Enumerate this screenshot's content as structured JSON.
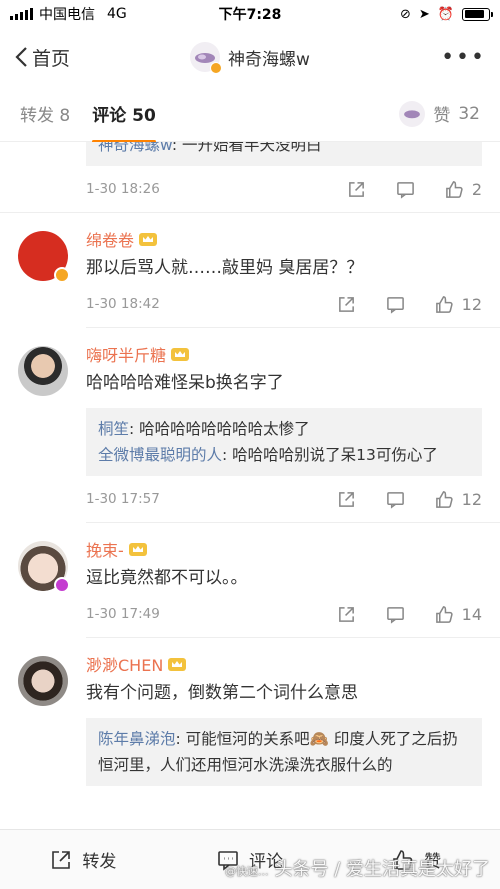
{
  "status": {
    "carrier": "中国电信",
    "network": "4G",
    "time": "下午7:28",
    "battery_level": 0.85
  },
  "nav": {
    "back_label": "首页",
    "title": "神奇海螺w"
  },
  "tabs": [
    {
      "label": "转发",
      "count": "8"
    },
    {
      "label": "评论",
      "count": "50"
    }
  ],
  "likes": {
    "label": "赞",
    "count": "32"
  },
  "top_fragment": {
    "user": "神奇海螺w",
    "text": ": 一开始看半天没明白",
    "time": "1-30 18:26",
    "likes": "2"
  },
  "comments": [
    {
      "user": "绵卷卷",
      "text": "那以后骂人就……敲里妈 臭居居？？",
      "time": "1-30 18:42",
      "likes": "12",
      "replies": []
    },
    {
      "user": "嗨呀半斤糖",
      "text": "哈哈哈哈难怪呆b换名字了",
      "time": "1-30 17:57",
      "likes": "12",
      "replies": [
        {
          "user": "桐笙",
          "text": ": 哈哈哈哈哈哈哈哈太惨了"
        },
        {
          "user": "全微博最聪明的人",
          "text": ": 哈哈哈哈别说了呆13可伤心了"
        }
      ]
    },
    {
      "user": "挽束-",
      "text": "逗比竟然都不可以。。",
      "time": "1-30 17:49",
      "likes": "14",
      "replies": []
    },
    {
      "user": "渺渺CHEN",
      "text": "我有个问题，倒数第二个词什么意思",
      "time": "",
      "likes": "",
      "replies": [
        {
          "user": "陈年鼻涕泡",
          "text": ": 可能恒河的关系吧🙈 印度人死了之后扔恒河里，人们还用恒河水洗澡洗衣服什么的"
        }
      ]
    }
  ],
  "bottom": {
    "repost": "转发",
    "comment": "评论",
    "like": "赞"
  },
  "watermark": {
    "small": "@快速...",
    "main": "头条号 / 爱生活真是太好了"
  },
  "colors": {
    "accent": "#ff8200",
    "username": "#eb7350",
    "reply_user": "#5d7ca9"
  }
}
